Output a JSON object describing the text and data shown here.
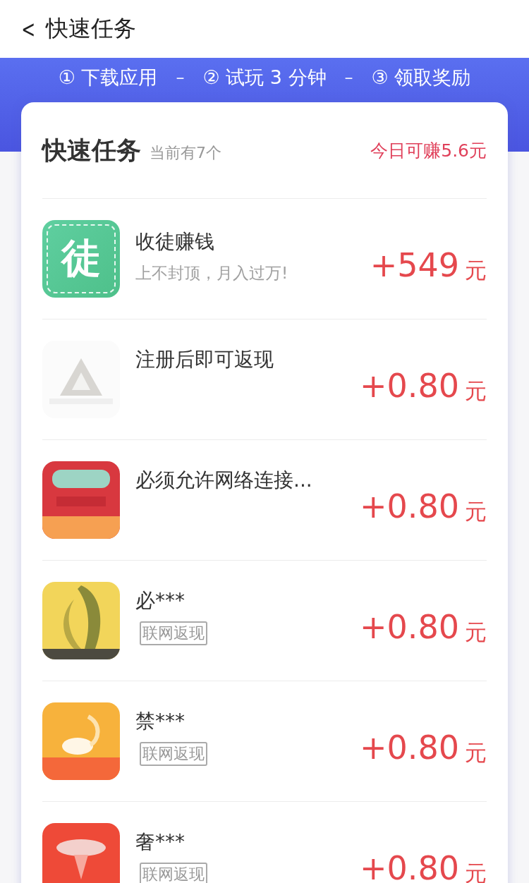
{
  "nav": {
    "back": "<",
    "title": "快速任务"
  },
  "steps": [
    {
      "kind": "step",
      "text": "① 下载应用"
    },
    {
      "kind": "dash",
      "text": "–"
    },
    {
      "kind": "step",
      "text": "② 试玩 3 分钟"
    },
    {
      "kind": "dash",
      "text": "–"
    },
    {
      "kind": "step",
      "text": "③ 领取奖励"
    }
  ],
  "card": {
    "title": "快速任务",
    "count": "当前有7个",
    "earn": "今日可赚5.6元"
  },
  "tasks": [
    {
      "kind": "promo",
      "icon_text": "徒",
      "title": "收徒赚钱",
      "subtitle": "上不封顶，月入过万!",
      "amount": "+549",
      "unit": "元"
    },
    {
      "kind": "plain",
      "title": "注册后即可返现",
      "amount": "+0.80",
      "unit": "元"
    },
    {
      "kind": "plain",
      "title": "必须允许网络连接...",
      "amount": "+0.80",
      "unit": "元"
    },
    {
      "kind": "tagged",
      "title": "必***",
      "tag": "联网返现",
      "amount": "+0.80",
      "unit": "元"
    },
    {
      "kind": "tagged",
      "title": "禁***",
      "tag": "联网返现",
      "amount": "+0.80",
      "unit": "元"
    },
    {
      "kind": "tagged",
      "title": "奢***",
      "tag": "联网返现",
      "amount": "+0.80",
      "unit": "元"
    }
  ]
}
